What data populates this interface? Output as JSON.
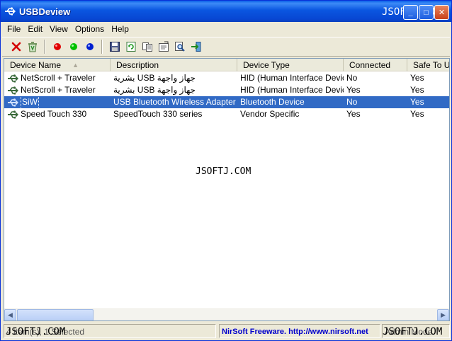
{
  "window": {
    "title": "USBDeview",
    "watermark": "JSOFTJ.COM",
    "buttons": {
      "minimize": "_",
      "maximize": "□",
      "close": "✕"
    }
  },
  "menu": [
    "File",
    "Edit",
    "View",
    "Options",
    "Help"
  ],
  "toolbar": {
    "icons": [
      "uninstall-icon",
      "recycle-icon",
      "red-dot-icon",
      "green-dot-icon",
      "blue-dot-icon",
      "save-icon",
      "refresh-icon",
      "copy-icon",
      "properties-icon",
      "find-icon",
      "exit-icon"
    ]
  },
  "list": {
    "columns": [
      "Device Name",
      "Description",
      "Device Type",
      "Connected",
      "Safe To Unplug"
    ],
    "sort_indicator": "▲",
    "rows": [
      {
        "name": "NetScroll + Traveler",
        "description": "بشرية USB جهاز واجهة",
        "type": "HID (Human Interface Device)",
        "connected": "No",
        "safe": "Yes",
        "selected": false
      },
      {
        "name": "NetScroll + Traveler",
        "description": "بشرية USB جهاز واجهة",
        "type": "HID (Human Interface Device)",
        "connected": "Yes",
        "safe": "Yes",
        "selected": false
      },
      {
        "name": "SiW",
        "description": "USB Bluetooth Wireless Adapter",
        "type": "Bluetooth Device",
        "connected": "No",
        "safe": "Yes",
        "selected": true
      },
      {
        "name": "Speed Touch 330",
        "description": "SpeedTouch 330 series",
        "type": "Vendor Specific",
        "connected": "Yes",
        "safe": "Yes",
        "selected": false
      }
    ],
    "center_watermark": "JSOFTJ.COM"
  },
  "statusbar": {
    "left_text": "4 item(s), 1 Selected",
    "left_watermark": "JSOFTJ.COM",
    "link_text": "NirSoft Freeware.  http://www.nirsoft.net",
    "right_text": "Admin Mode",
    "right_watermark": "JSOFTJ.COM"
  },
  "colors": {
    "titlebar": "#0a56e0",
    "selection": "#316ac5",
    "link": "#0000cc",
    "chrome": "#ece9d8"
  }
}
